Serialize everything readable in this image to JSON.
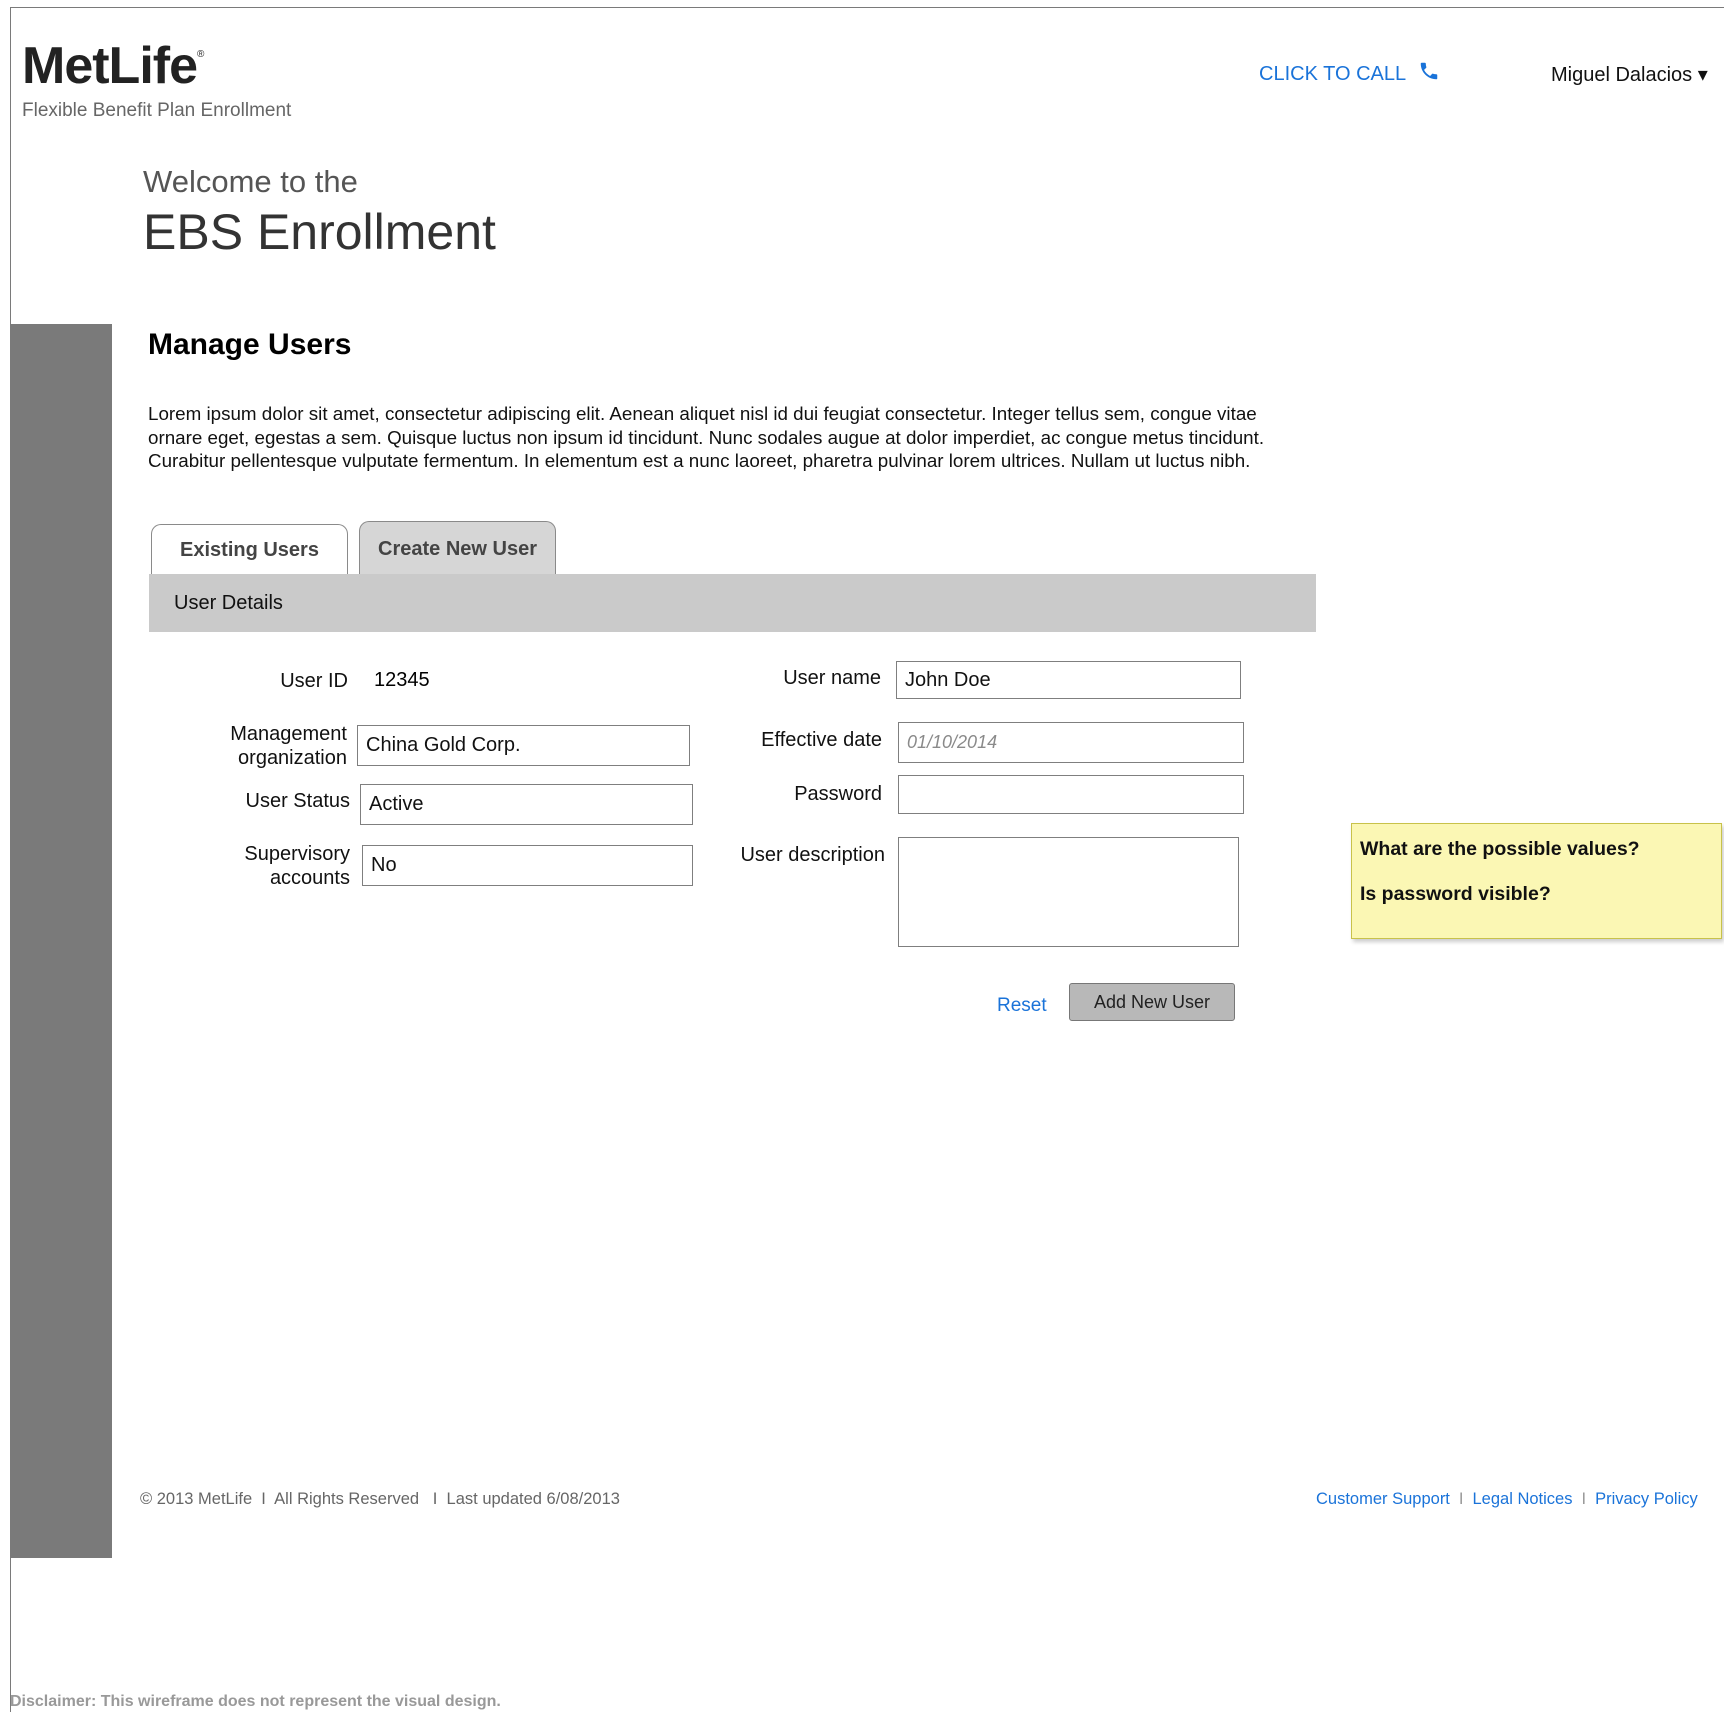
{
  "header": {
    "logo_text": "MetLife",
    "logo_mark": "®",
    "subtitle": "Flexible Benefit Plan Enrollment",
    "click_to_call": "CLICK TO CALL",
    "call_icon": "phone-icon",
    "user_name": "Miguel Dalacios ▾"
  },
  "welcome": {
    "line1": "Welcome to the",
    "line2": "EBS Enrollment"
  },
  "page": {
    "title": "Manage Users",
    "description": "Lorem ipsum dolor sit amet, consectetur adipiscing elit. Aenean aliquet nisl id dui feugiat consectetur. Integer tellus sem, congue vitae ornare eget, egestas a sem. Quisque luctus non ipsum id tincidunt. Nunc sodales augue at dolor imperdiet, ac congue metus tincidunt. Curabitur pellentesque vulputate fermentum. In elementum est a nunc laoreet, pharetra pulvinar lorem ultrices. Nullam ut luctus nibh."
  },
  "tabs": [
    {
      "label": "Existing Users"
    },
    {
      "label": "Create New User",
      "selected": true
    }
  ],
  "section": {
    "title": "User Details"
  },
  "form": {
    "user_id_label": "User ID",
    "user_id_value": "12345",
    "mgmt_org_label_1": "Management",
    "mgmt_org_label_2": "organization",
    "mgmt_org_value": "China Gold Corp.",
    "user_status_label": "User Status",
    "user_status_value": "Active",
    "supervisory_label_1": "Supervisory",
    "supervisory_label_2": "accounts",
    "supervisory_value": "No",
    "user_name_label": "User name",
    "user_name_value": "John Doe",
    "effective_date_label": "Effective date",
    "effective_date_placeholder": "01/10/2014",
    "password_label": "Password",
    "password_value": "",
    "user_description_label": "User description",
    "user_description_value": ""
  },
  "actions": {
    "reset_label": "Reset",
    "add_label": "Add New User"
  },
  "note": {
    "line1": "What are the possible values?",
    "line2": "Is password visible?"
  },
  "footer": {
    "left": "© 2013 MetLife  I  All Rights Reserved   I  Last updated 6/08/2013",
    "separator": "I",
    "customer_support": "Customer Support",
    "legal_notices": "Legal Notices",
    "privacy_policy": "Privacy Policy"
  },
  "disclaimer": "Disclaimer: This wireframe does not represent the visual design.",
  "colors": {
    "link": "#1a73d9",
    "sidebar": "#7a7a7a",
    "section_bar": "#cacaca",
    "note_bg": "#fbf7b4"
  }
}
